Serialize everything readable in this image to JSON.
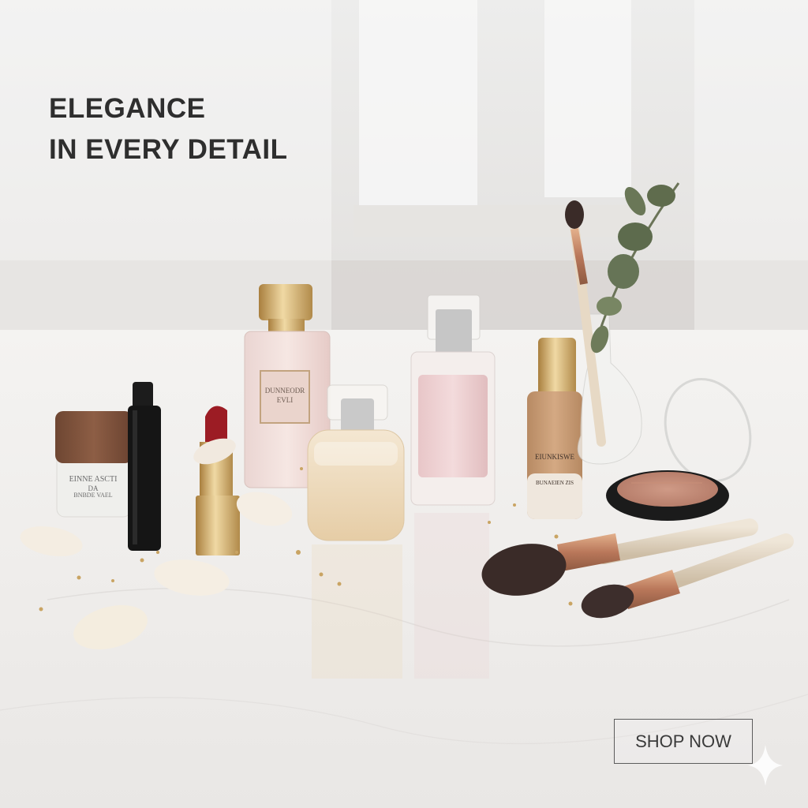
{
  "hero": {
    "headline_line1": "ELEGANCE",
    "headline_line2": "IN EVERY DETAIL"
  },
  "cta": {
    "label": "SHOP NOW"
  },
  "products": {
    "cream_label_1": "EINNE ASCTI",
    "cream_label_2": "DA",
    "cream_label_3": "BNBDE VAEL",
    "perfume_left_label_1": "DUNNEODR",
    "perfume_left_label_2": "EVLI",
    "foundation_label_1": "EIUNKISWE",
    "foundation_label_2": "BUNAEIEN ZIS"
  },
  "palette": {
    "marble": "#f1efed",
    "gold": "#c9a463",
    "lipstick": "#9c1c24",
    "blush": "#c8907a",
    "foundation": "#c69a72",
    "copper": "#b9775a"
  },
  "icons": {
    "sparkle": "sparkle-icon"
  }
}
